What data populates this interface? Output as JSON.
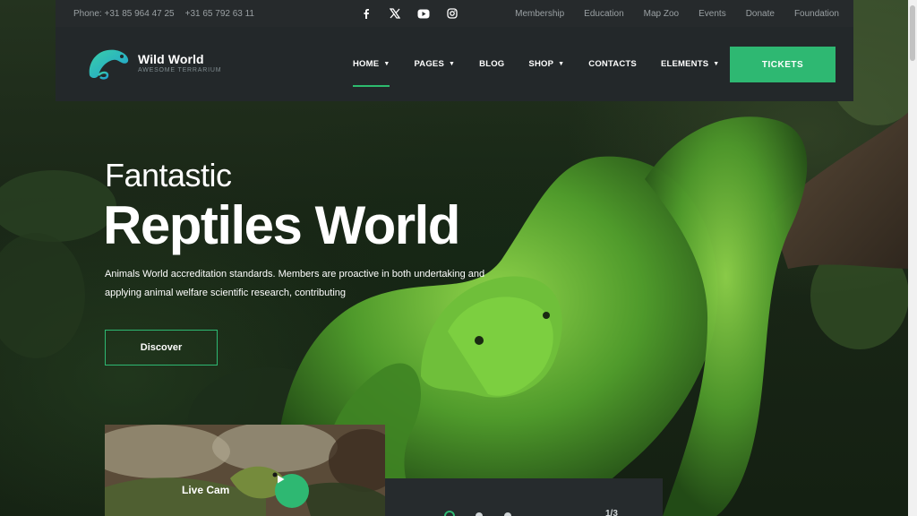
{
  "topbar": {
    "phone_1": "Phone: +31 85 964 47 25",
    "phone_2": "+31 65 792 63 11",
    "social": [
      "facebook-icon",
      "x-icon",
      "youtube-icon",
      "instagram-icon"
    ],
    "links": [
      "Membership",
      "Education",
      "Map Zoo",
      "Events",
      "Donate",
      "Foundation"
    ]
  },
  "logo": {
    "title": "Wild World",
    "subtitle": "AWESOME TERRARIUM",
    "icon": "chameleon-icon"
  },
  "nav": {
    "items": [
      {
        "label": "HOME",
        "has_dropdown": true,
        "active": true
      },
      {
        "label": "PAGES",
        "has_dropdown": true,
        "active": false
      },
      {
        "label": "BLOG",
        "has_dropdown": false,
        "active": false
      },
      {
        "label": "SHOP",
        "has_dropdown": true,
        "active": false
      },
      {
        "label": "CONTACTS",
        "has_dropdown": false,
        "active": false
      },
      {
        "label": "ELEMENTS",
        "has_dropdown": true,
        "active": false
      }
    ],
    "tickets_label": "TICKETS"
  },
  "hero": {
    "pretitle": "Fantastic",
    "title": "Reptiles World",
    "description": "Animals World accreditation standards. Members are proactive in both undertaking and applying animal welfare scientific research, contributing",
    "button_label": "Discover"
  },
  "livecam": {
    "label": "Live Cam",
    "play_icon": "play-icon"
  },
  "slider": {
    "counter": "1/3",
    "current": 1,
    "total": 3
  },
  "colors": {
    "accent": "#2eb872",
    "header_bg": "#23282a",
    "topbar_bg": "#262a2c"
  }
}
